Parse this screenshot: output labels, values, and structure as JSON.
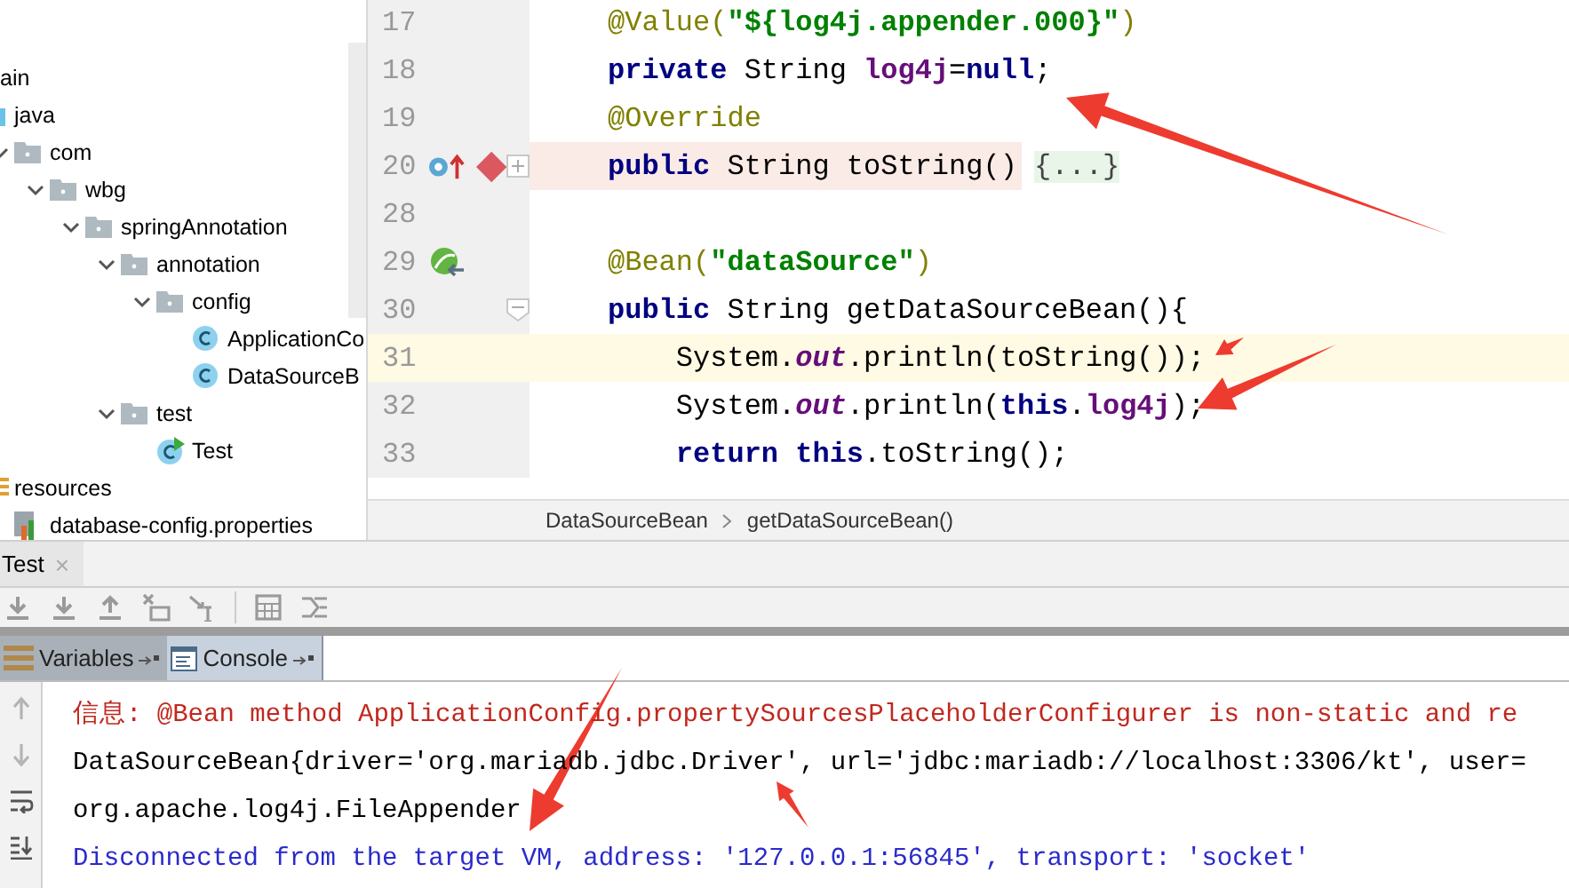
{
  "project_tree": [
    {
      "label": "ain",
      "children": [
        {
          "label": "java",
          "kind": "source-folder",
          "children": [
            {
              "label": "com",
              "kind": "folder",
              "expanded": true,
              "children": [
                {
                  "label": "wbg",
                  "kind": "folder",
                  "expanded": true,
                  "children": [
                    {
                      "label": "springAnnotation",
                      "kind": "folder",
                      "expanded": true,
                      "children": [
                        {
                          "label": "annotation",
                          "kind": "folder",
                          "expanded": true,
                          "children": [
                            {
                              "label": "config",
                              "kind": "folder",
                              "expanded": true,
                              "children": [
                                {
                                  "label": "ApplicationCo",
                                  "kind": "class"
                                },
                                {
                                  "label": "DataSourceB",
                                  "kind": "class"
                                }
                              ]
                            }
                          ]
                        },
                        {
                          "label": "test",
                          "kind": "folder",
                          "expanded": true,
                          "children": [
                            {
                              "label": "Test",
                              "kind": "test-class"
                            }
                          ]
                        }
                      ]
                    }
                  ]
                }
              ]
            }
          ]
        },
        {
          "label": "resources",
          "kind": "resource-folder",
          "children": [
            {
              "label": "database-config.properties",
              "kind": "properties-file"
            }
          ]
        }
      ]
    }
  ],
  "editor": {
    "lines": [
      {
        "number": "17",
        "kind": "plain",
        "tokens": [
          {
            "text": "@Value(",
            "kind": "annotation"
          },
          {
            "text": "\"${log4j.appender.000}\"",
            "kind": "string"
          },
          {
            "text": ")",
            "kind": "annotation"
          }
        ]
      },
      {
        "number": "18",
        "kind": "plain",
        "tokens": [
          {
            "text": "private",
            "kind": "keyword"
          },
          {
            "text": " String ",
            "kind": "plain"
          },
          {
            "text": "log4j",
            "kind": "field"
          },
          {
            "text": "=",
            "kind": "plain"
          },
          {
            "text": "null",
            "kind": "keyword"
          },
          {
            "text": ";",
            "kind": "plain"
          }
        ]
      },
      {
        "number": "19",
        "kind": "plain",
        "tokens": [
          {
            "text": "@Override",
            "kind": "annotation"
          }
        ]
      },
      {
        "number": "20",
        "breakpoint": true,
        "kind": "override",
        "folded": true,
        "tokens": [
          {
            "text": "public",
            "kind": "keyword"
          },
          {
            "text": " String toString() ",
            "kind": "plain"
          },
          {
            "text": "{...}",
            "kind": "folded"
          }
        ]
      },
      {
        "number": "28",
        "kind": "plain"
      },
      {
        "number": "29",
        "kind": "bean",
        "tokens": [
          {
            "text": "@Bean(",
            "kind": "annotation"
          },
          {
            "text": "\"dataSource\"",
            "kind": "string"
          },
          {
            "text": ")",
            "kind": "annotation"
          }
        ]
      },
      {
        "number": "30",
        "kind": "plain",
        "folded": false,
        "tokens": [
          {
            "text": "public",
            "kind": "keyword"
          },
          {
            "text": " String getDataSourceBean(){",
            "kind": "plain"
          }
        ]
      },
      {
        "number": "31",
        "kind": "plain",
        "current": true,
        "tokens": [
          {
            "text": "    System.",
            "kind": "plain"
          },
          {
            "text": "out",
            "kind": "static"
          },
          {
            "text": ".println(toString());",
            "kind": "plain"
          }
        ]
      },
      {
        "number": "32",
        "kind": "plain",
        "tokens": [
          {
            "text": "    System.",
            "kind": "plain"
          },
          {
            "text": "out",
            "kind": "static"
          },
          {
            "text": ".println(",
            "kind": "plain"
          },
          {
            "text": "this",
            "kind": "keyword"
          },
          {
            "text": ".",
            "kind": "plain"
          },
          {
            "text": "log4j",
            "kind": "field"
          },
          {
            "text": ");",
            "kind": "plain"
          }
        ]
      },
      {
        "number": "33",
        "kind": "plain",
        "tokens": [
          {
            "text": "    return this",
            "kind": "keyword"
          },
          {
            "text": ".toString();",
            "kind": "plain"
          }
        ]
      }
    ],
    "breadcrumb": [
      "DataSourceBean",
      "getDataSourceBean()"
    ]
  },
  "debug": {
    "session_tab": "Test",
    "close": "×",
    "tabs": [
      {
        "label": "Variables",
        "selected": false
      },
      {
        "label": "Console",
        "selected": true
      }
    ],
    "console": [
      {
        "kind": "error",
        "text": "信息: @Bean method ApplicationConfig.propertySourcesPlaceholderConfigurer is non-static and re"
      },
      {
        "kind": "output",
        "text": "DataSourceBean{driver='org.mariadb.jdbc.Driver', url='jdbc:mariadb://localhost:3306/kt', user="
      },
      {
        "kind": "output",
        "text": "org.apache.log4j.FileAppender"
      },
      {
        "kind": "system",
        "text": "Disconnected from the target VM, address: '127.0.0.1:56845', transport: 'socket'"
      }
    ]
  }
}
